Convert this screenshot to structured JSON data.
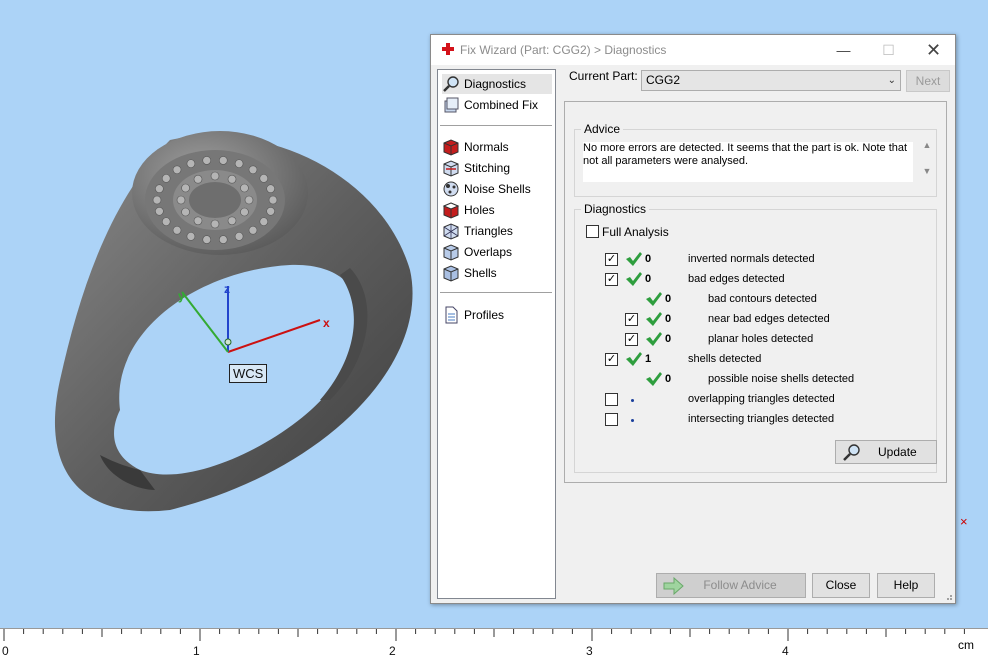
{
  "viewport": {
    "wcs_label": "WCS",
    "axis_labels": {
      "x": "x",
      "y": "y",
      "z": "z"
    },
    "side_marker": "×"
  },
  "ruler": {
    "unit": "cm",
    "labels": [
      "0",
      "1",
      "2",
      "3",
      "4"
    ]
  },
  "dialog": {
    "title": "Fix Wizard (Part: CGG2) > Diagnostics",
    "window_controls": {
      "minimize": "—",
      "maximize": "☐",
      "close": "✕"
    },
    "nav": {
      "top_items": [
        {
          "label": "Diagnostics",
          "icon": "magnifier-icon",
          "selected": true
        },
        {
          "label": "Combined Fix",
          "icon": "combined-fix-icon",
          "selected": false
        }
      ],
      "fix_items": [
        {
          "label": "Normals",
          "icon": "normals-icon"
        },
        {
          "label": "Stitching",
          "icon": "stitching-icon"
        },
        {
          "label": "Noise Shells",
          "icon": "noise-shells-icon"
        },
        {
          "label": "Holes",
          "icon": "holes-icon"
        },
        {
          "label": "Triangles",
          "icon": "triangles-icon"
        },
        {
          "label": "Overlaps",
          "icon": "overlaps-icon"
        },
        {
          "label": "Shells",
          "icon": "shells-icon"
        }
      ],
      "bottom_items": [
        {
          "label": "Profiles",
          "icon": "document-icon"
        }
      ]
    },
    "current_part_label": "Current Part:",
    "current_part_value": "CGG2",
    "next_label": "Next",
    "advice_title": "Advice",
    "advice_text": "No more errors are detected. It seems that the part is ok. Note that not all parameters were analysed.",
    "diagnostics_title": "Diagnostics",
    "full_analysis_label": "Full Analysis",
    "full_analysis_checked": false,
    "rows": [
      {
        "checked": true,
        "has_checkbox": true,
        "status": "ok",
        "count": "0",
        "label": "inverted normals detected",
        "indent": 0
      },
      {
        "checked": true,
        "has_checkbox": true,
        "status": "ok",
        "count": "0",
        "label": "bad edges detected",
        "indent": 0
      },
      {
        "checked": false,
        "has_checkbox": false,
        "status": "ok",
        "count": "0",
        "label": "bad contours detected",
        "indent": 1
      },
      {
        "checked": true,
        "has_checkbox": true,
        "status": "ok",
        "count": "0",
        "label": "near bad edges detected",
        "indent": 1
      },
      {
        "checked": true,
        "has_checkbox": true,
        "status": "ok",
        "count": "0",
        "label": "planar holes detected",
        "indent": 1
      },
      {
        "checked": true,
        "has_checkbox": true,
        "status": "ok",
        "count": "1",
        "label": "shells detected",
        "indent": 0
      },
      {
        "checked": false,
        "has_checkbox": false,
        "status": "ok",
        "count": "0",
        "label": "possible noise shells detected",
        "indent": 1
      },
      {
        "checked": false,
        "has_checkbox": true,
        "status": "none",
        "count": "",
        "label": "overlapping triangles detected",
        "indent": 0
      },
      {
        "checked": false,
        "has_checkbox": true,
        "status": "none",
        "count": "",
        "label": "intersecting triangles detected",
        "indent": 0
      }
    ],
    "update_label": "Update",
    "follow_advice_label": "Follow Advice",
    "close_label": "Close",
    "help_label": "Help",
    "colors": {
      "accent_green": "#2e9e3e",
      "title_icon_red": "#d4121a"
    }
  }
}
